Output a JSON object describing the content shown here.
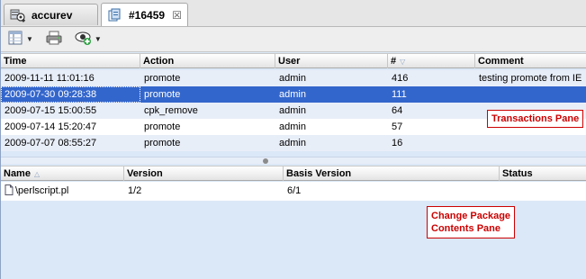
{
  "tabs": [
    {
      "label": "accurev",
      "icon": "depot-icon"
    },
    {
      "label": "#16459",
      "icon": "change-package-icon",
      "close": "☒"
    }
  ],
  "toolbar": {
    "items": [
      {
        "icon": "columns-icon",
        "dropdown": true
      },
      {
        "icon": "printer-icon",
        "dropdown": false
      },
      {
        "icon": "add-view-icon",
        "dropdown": true
      }
    ]
  },
  "transactions": {
    "columns": [
      "Time",
      "Action",
      "User",
      "#",
      "Comment"
    ],
    "sorted_column": "#",
    "rows": [
      {
        "time": "2009-11-11 11:01:16",
        "action": "promote",
        "user": "admin",
        "num": "416",
        "comment": "testing promote from IE"
      },
      {
        "time": "2009-07-30 09:28:38",
        "action": "promote",
        "user": "admin",
        "num": "111",
        "comment": ""
      },
      {
        "time": "2009-07-15 15:00:55",
        "action": "cpk_remove",
        "user": "admin",
        "num": "64",
        "comment": ""
      },
      {
        "time": "2009-07-14 15:20:47",
        "action": "promote",
        "user": "admin",
        "num": "57",
        "comment": ""
      },
      {
        "time": "2009-07-07 08:55:27",
        "action": "promote",
        "user": "admin",
        "num": "16",
        "comment": ""
      }
    ],
    "selected_row": 1,
    "callout": "Transactions Pane"
  },
  "contents": {
    "columns": [
      "Name",
      "Version",
      "Basis Version",
      "Status"
    ],
    "sorted_column": "Name",
    "rows": [
      {
        "name": "\\perlscript.pl",
        "version": "1/2",
        "basis": "6/1",
        "status": ""
      }
    ],
    "callout_lines": [
      "Change Package",
      "Contents Pane"
    ]
  },
  "colors": {
    "selection": "#3366cc",
    "alt_row": "#e8eef8",
    "callout": "#cc0000",
    "pane_bg": "#dbe8f7"
  }
}
